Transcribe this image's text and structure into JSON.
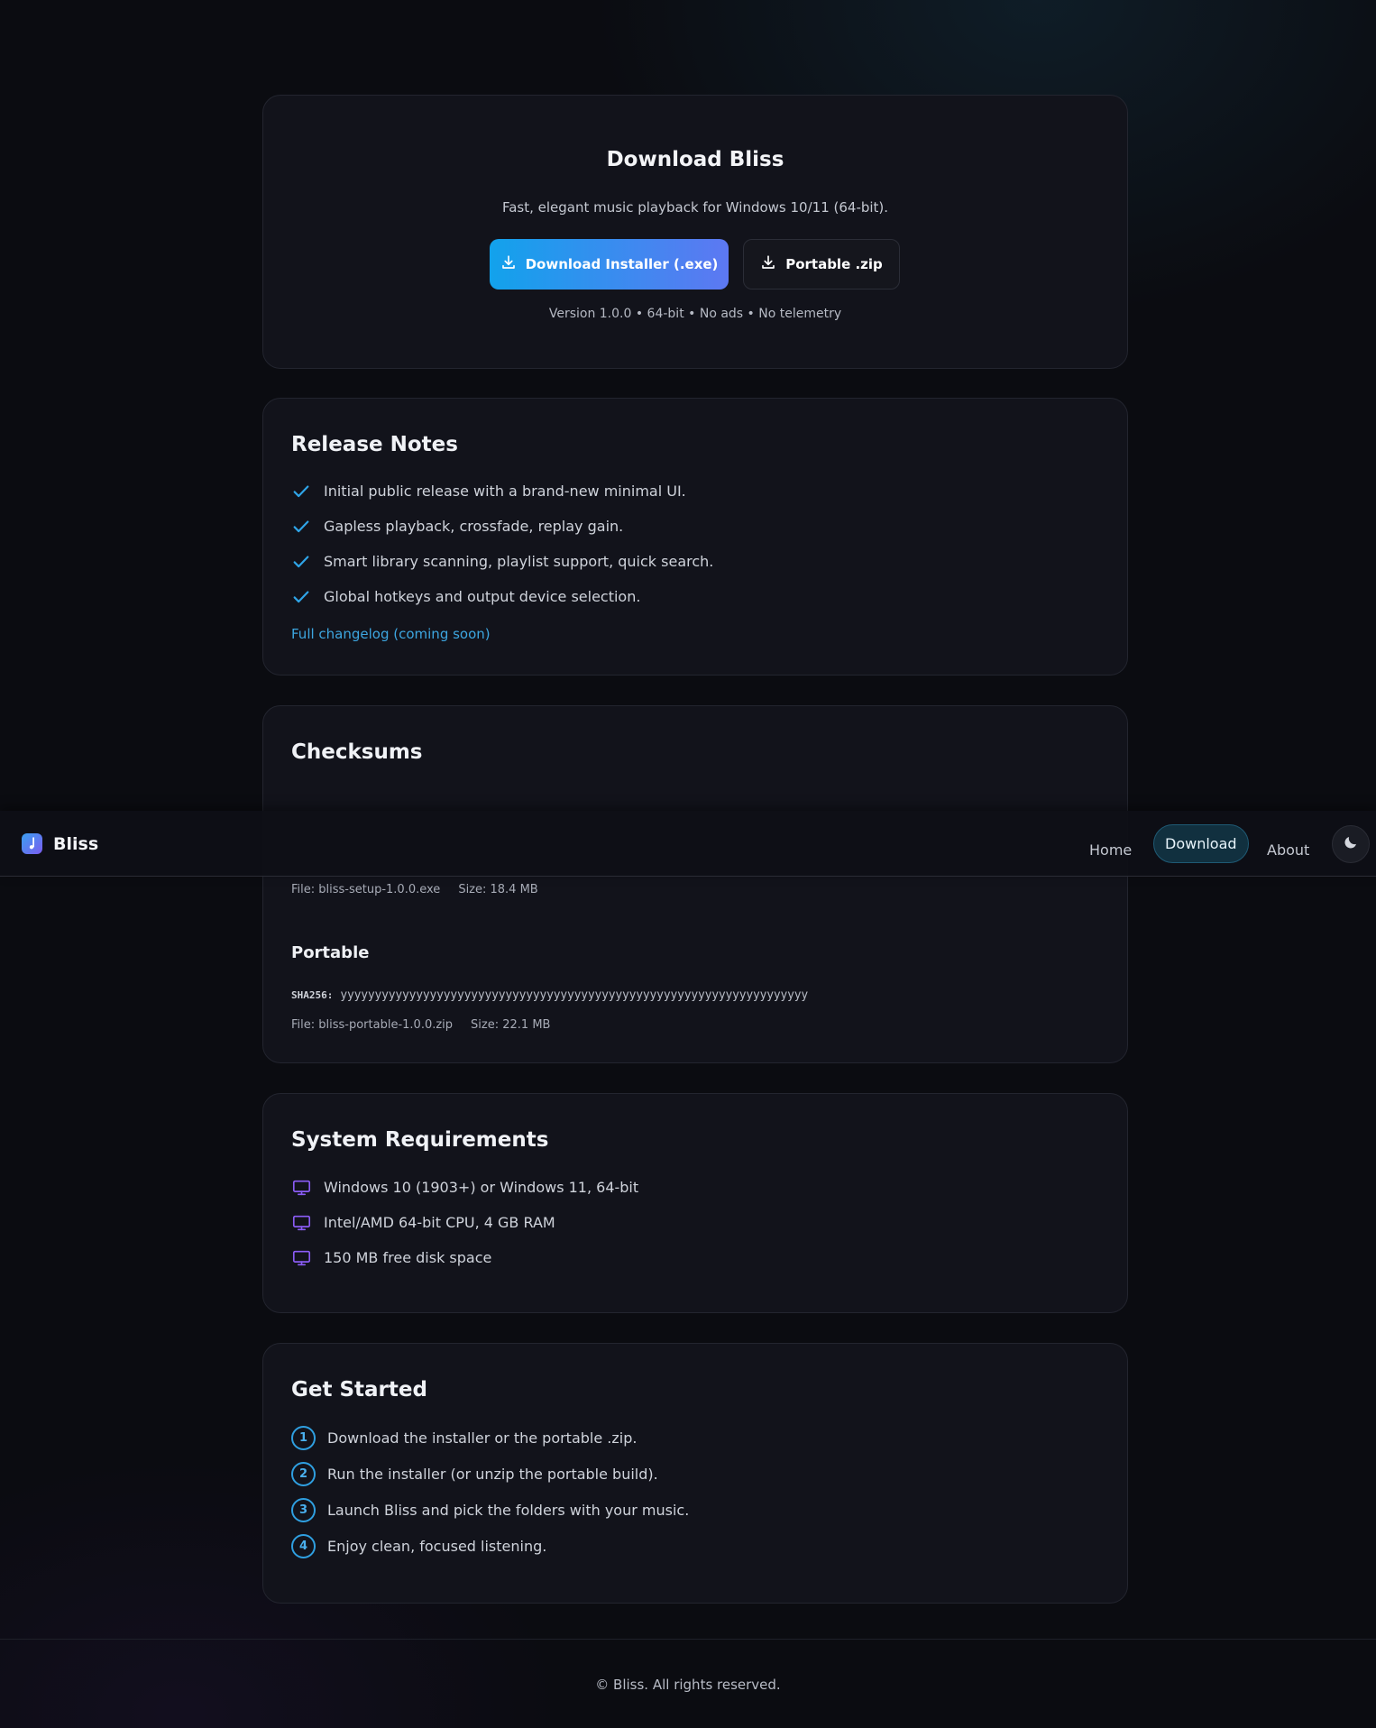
{
  "nav": {
    "brand": "Bliss",
    "links": [
      {
        "label": "Home"
      },
      {
        "label": "Download"
      },
      {
        "label": "About"
      }
    ],
    "theme_icon": "moon-icon"
  },
  "hero": {
    "title": "Download Bliss",
    "subtitle": "Fast, elegant music playback for Windows 10/11 (64-bit).",
    "installer_button": "Download Installer (.exe)",
    "zip_button": "Portable .zip",
    "meta": "Version 1.0.0 • 64-bit • No ads • No telemetry"
  },
  "release_notes": {
    "title": "Release Notes",
    "items": [
      "Initial public release with a brand-new minimal UI.",
      "Gapless playback, crossfade, replay gain.",
      "Smart library scanning, playlist support, quick search.",
      "Global hotkeys and output device selection."
    ],
    "link": "Full changelog (coming soon)"
  },
  "checksums": {
    "title": "Checksums",
    "installer": {
      "file": "File: bliss-setup-1.0.0.exe",
      "size": "Size: 18.4 MB"
    },
    "portable": {
      "heading": "Portable",
      "sha_label": "SHA256:",
      "sha_value": "yyyyyyyyyyyyyyyyyyyyyyyyyyyyyyyyyyyyyyyyyyyyyyyyyyyyyyyyyyyyyyyyyyyy",
      "file": "File: bliss-portable-1.0.0.zip",
      "size": "Size: 22.1 MB"
    }
  },
  "system_requirements": {
    "title": "System Requirements",
    "items": [
      "Windows 10 (1903+) or Windows 11, 64-bit",
      "Intel/AMD 64-bit CPU, 4 GB RAM",
      "150 MB free disk space"
    ]
  },
  "get_started": {
    "title": "Get Started",
    "steps": [
      {
        "num": "1",
        "text": "Download the installer or the portable .zip."
      },
      {
        "num": "2",
        "text": "Run the installer (or unzip the portable build)."
      },
      {
        "num": "3",
        "text": "Launch Bliss and pick the folders with your music."
      },
      {
        "num": "4",
        "text": "Enjoy clean, focused listening."
      }
    ]
  },
  "footer": {
    "text": "© Bliss. All rights reserved."
  },
  "colors": {
    "accent": "#3da6e0",
    "accent_gradient_start": "#12a2ec",
    "accent_gradient_end": "#5d78f2",
    "monitor_icon": "#8b5cf6",
    "background": "#0b0c11",
    "card": "#12131b"
  }
}
